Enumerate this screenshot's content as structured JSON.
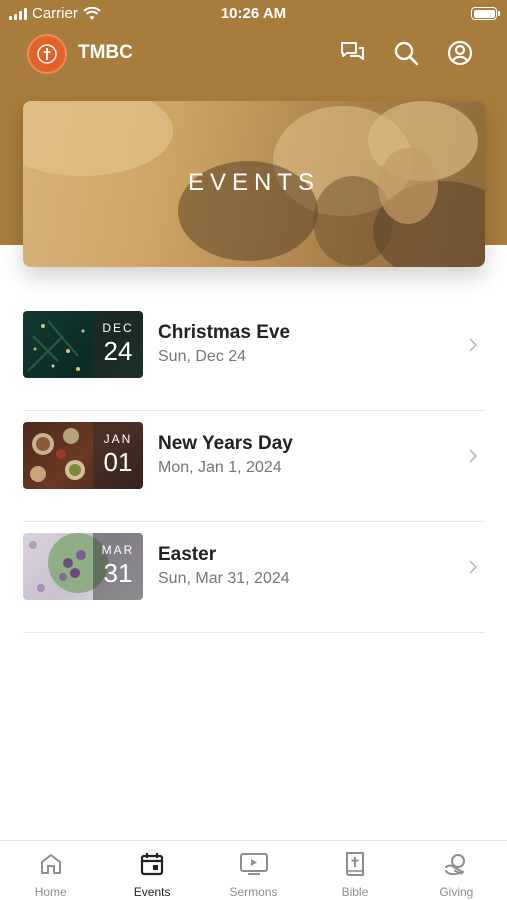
{
  "status_bar": {
    "carrier": "Carrier",
    "time": "10:26 AM"
  },
  "app": {
    "title": "TMBC"
  },
  "hero": {
    "title": "EVENTS"
  },
  "events": [
    {
      "title": "Christmas Eve",
      "date": "Sun, Dec 24",
      "month": "DEC",
      "day": "24"
    },
    {
      "title": "New Years Day",
      "date": "Mon, Jan 1, 2024",
      "month": "JAN",
      "day": "01"
    },
    {
      "title": "Easter",
      "date": "Sun, Mar 31, 2024",
      "month": "MAR",
      "day": "31"
    }
  ],
  "tabs": [
    {
      "label": "Home",
      "icon": "home-icon"
    },
    {
      "label": "Events",
      "icon": "calendar-icon",
      "active": true
    },
    {
      "label": "Sermons",
      "icon": "video-icon"
    },
    {
      "label": "Bible",
      "icon": "bible-icon"
    },
    {
      "label": "Giving",
      "icon": "giving-icon"
    }
  ],
  "colors": {
    "header": "#a87c3c",
    "logo": "#e2632a",
    "active_tab": "#222222",
    "inactive_tab": "#8e8e8e"
  }
}
